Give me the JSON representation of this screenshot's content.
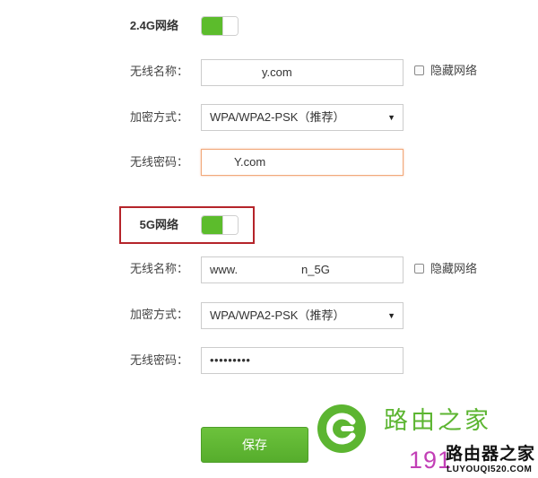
{
  "band_24g": {
    "label": "2.4G网络",
    "enabled": true,
    "ssid_label": "无线名称：",
    "ssid_value": "y.com",
    "hide_label": "隐藏网络",
    "security_label": "加密方式：",
    "security_value": "WPA/WPA2-PSK（推荐）",
    "password_label": "无线密码：",
    "password_value": "Y.com"
  },
  "band_5g": {
    "label": "5G网络",
    "enabled": true,
    "ssid_label": "无线名称：",
    "ssid_value_prefix": "www.",
    "ssid_value_suffix": "n_5G",
    "hide_label": "隐藏网络",
    "security_label": "加密方式：",
    "security_value": "WPA/WPA2-PSK（推荐）",
    "password_label": "无线密码：",
    "password_value": "•••••••••"
  },
  "save_label": "保存",
  "watermark": {
    "brand_cn": "路由之家",
    "number": "191",
    "brand_black": "路由器之家",
    "url": "LUYOUQI520.COM"
  },
  "colors": {
    "accent_green": "#5cbc2c",
    "highlight_red": "#b5242a",
    "focus_orange": "#f2a97a"
  }
}
